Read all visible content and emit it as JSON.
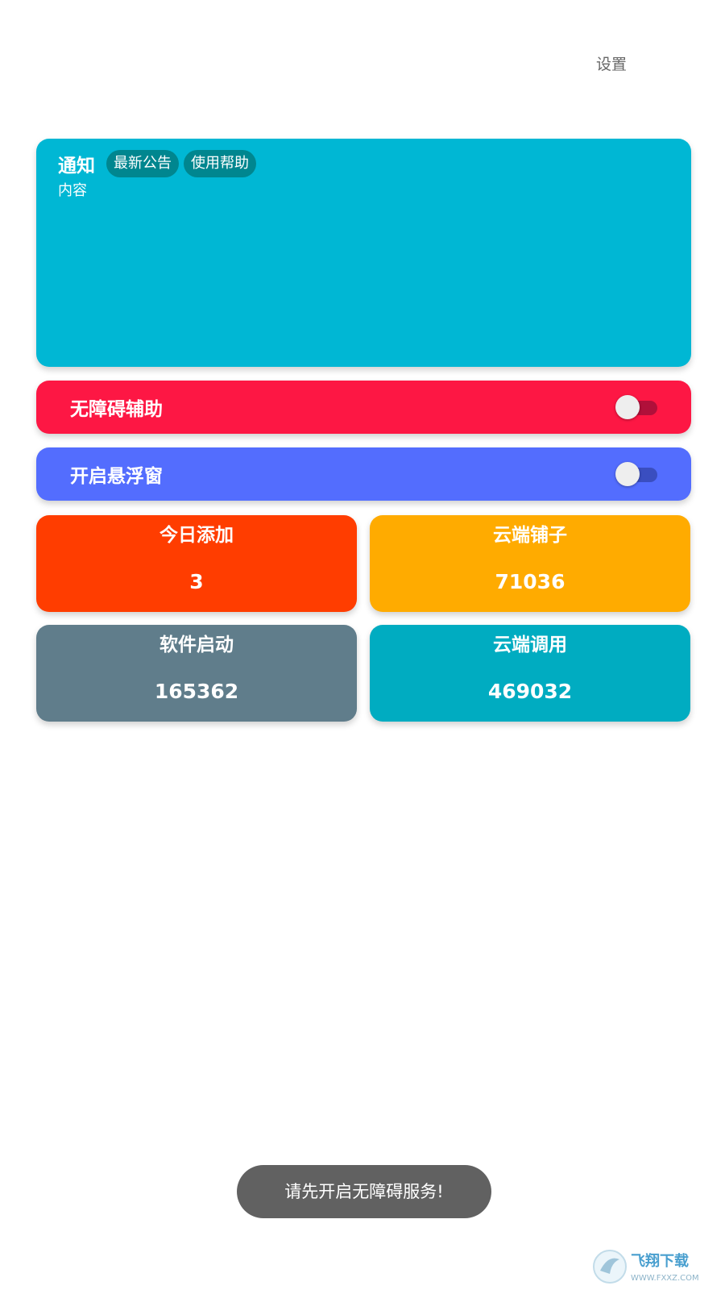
{
  "header": {
    "settings_label": "设置"
  },
  "notice": {
    "title": "通知",
    "chips": [
      "最新公告",
      "使用帮助"
    ],
    "content": "内容"
  },
  "toggles": {
    "accessibility": {
      "label": "无障碍辅助",
      "enabled": false
    },
    "floating_window": {
      "label": "开启悬浮窗",
      "enabled": false
    }
  },
  "stats": [
    {
      "label": "今日添加",
      "value": "3"
    },
    {
      "label": "云端铺子",
      "value": "71036"
    },
    {
      "label": "软件启动",
      "value": "165362"
    },
    {
      "label": "云端调用",
      "value": "469032"
    }
  ],
  "toast": {
    "message": "请先开启无障碍服务!"
  },
  "watermark": {
    "brand": "飞翔下载",
    "url": "WWW.FXXZ.COM"
  },
  "colors": {
    "notice": "#00b7d4",
    "chip": "#00868f",
    "a11y": "#fd1744",
    "a11y_track": "#b0103a",
    "float": "#536dfe",
    "float_track": "#3a4ec0",
    "stat_today": "#ff3d00",
    "stat_shop": "#ffab00",
    "stat_launch": "#607d8b",
    "stat_calls": "#00acc1"
  }
}
